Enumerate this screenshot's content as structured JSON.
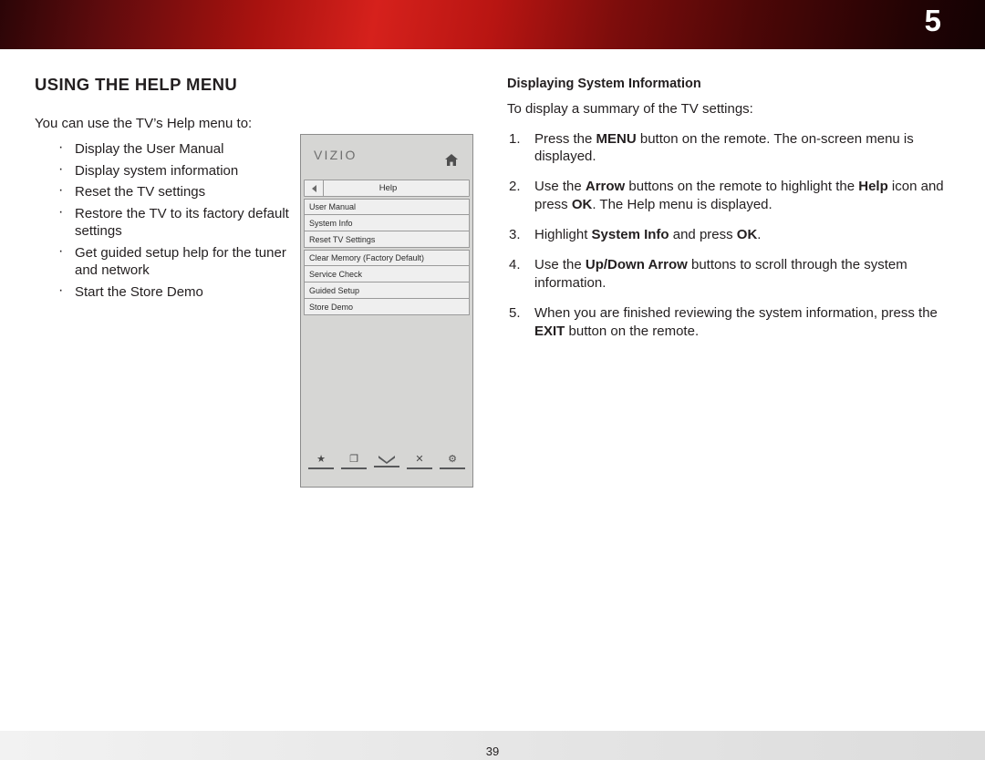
{
  "banner": {
    "chapter_number": "5"
  },
  "page": {
    "number": "39"
  },
  "left": {
    "title": "USING THE HELP MENU",
    "intro": "You can use the TV’s Help menu to:",
    "bullets": [
      "Display the User Manual",
      "Display system information",
      "Reset the TV settings",
      "Restore the TV to its factory default settings",
      "Get guided setup help for the tuner and network",
      "Start the Store Demo"
    ]
  },
  "tv_menu": {
    "brand": "VIZIO",
    "home_icon": "home-icon",
    "back_icon": "back-arrow-icon",
    "header_label": "Help",
    "items": [
      "User Manual",
      "System Info",
      "Reset TV Settings",
      "Clear Memory (Factory Default)",
      "Service Check",
      "Guided Setup",
      "Store Demo"
    ],
    "footer_icons": [
      "star-icon",
      "picture-icon",
      "chevron-down-icon",
      "close-icon",
      "gear-icon"
    ],
    "footer_glyphs": [
      "★",
      "❐",
      "❯",
      "✕",
      "⚙"
    ]
  },
  "right": {
    "heading": "Displaying System Information",
    "lead": "To display a summary of the TV settings:",
    "steps": [
      {
        "parts": [
          {
            "t": "Press the ",
            "b": false
          },
          {
            "t": "MENU",
            "b": true
          },
          {
            "t": " button on the remote. The on-screen menu is displayed.",
            "b": false
          }
        ]
      },
      {
        "parts": [
          {
            "t": "Use the ",
            "b": false
          },
          {
            "t": "Arrow",
            "b": true
          },
          {
            "t": " buttons on the remote to highlight the ",
            "b": false
          },
          {
            "t": "Help",
            "b": true
          },
          {
            "t": " icon and press ",
            "b": false
          },
          {
            "t": "OK",
            "b": true
          },
          {
            "t": ". The Help menu is displayed.",
            "b": false
          }
        ]
      },
      {
        "parts": [
          {
            "t": "Highlight ",
            "b": false
          },
          {
            "t": "System Info",
            "b": true
          },
          {
            "t": " and press ",
            "b": false
          },
          {
            "t": "OK",
            "b": true
          },
          {
            "t": ".",
            "b": false
          }
        ]
      },
      {
        "parts": [
          {
            "t": "Use the ",
            "b": false
          },
          {
            "t": "Up/Down Arrow",
            "b": true
          },
          {
            "t": " buttons to scroll through the system information.",
            "b": false
          }
        ]
      },
      {
        "parts": [
          {
            "t": "When you are finished reviewing the system information, press the ",
            "b": false
          },
          {
            "t": "EXIT",
            "b": true
          },
          {
            "t": " button on the remote.",
            "b": false
          }
        ]
      }
    ]
  }
}
